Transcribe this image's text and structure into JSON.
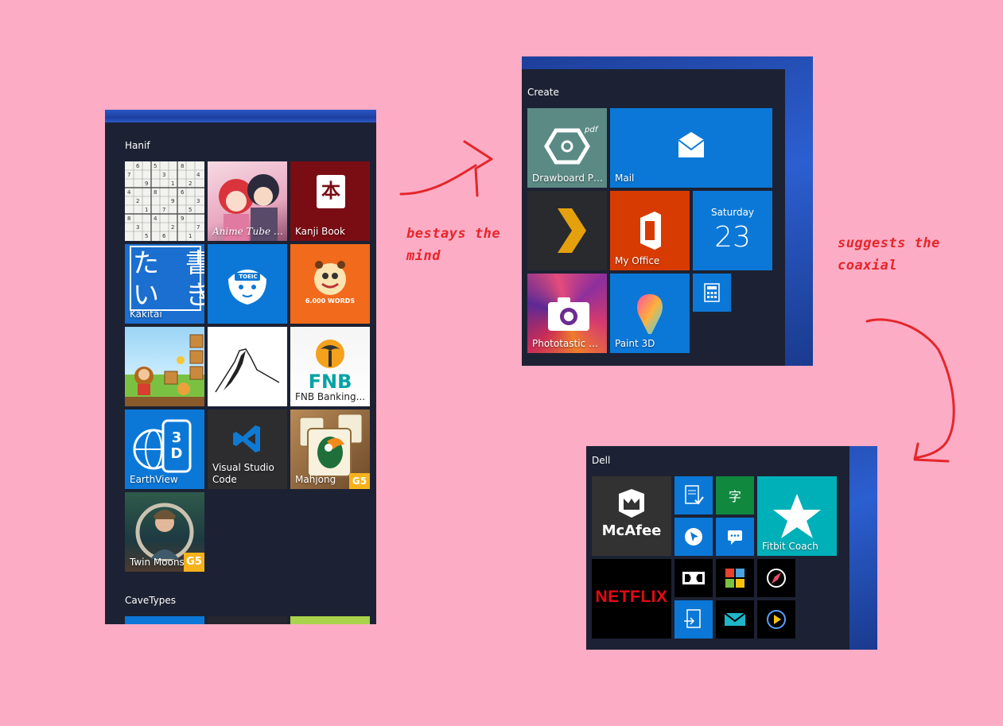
{
  "panel1": {
    "group_title": "Hanif",
    "tiles": [
      {
        "label": "",
        "icon": "sudoku-icon"
      },
      {
        "label": "Anime Tube Pro",
        "icon": "anime-icon"
      },
      {
        "label": "Kanji Book",
        "icon": "kanji-book-icon",
        "glyph": "本"
      },
      {
        "label": "Kakitai",
        "icon": "kakitai-icon",
        "glyph": "た　書\nい　き"
      },
      {
        "label": "",
        "icon": "toeic-icon",
        "glyph": "TOEIC"
      },
      {
        "label": "6.000 WORDS",
        "icon": "words-icon"
      },
      {
        "label": "",
        "icon": "platformer-game-icon"
      },
      {
        "label": "",
        "icon": "mountain-icon"
      },
      {
        "label": "FNB Banking...",
        "icon": "fnb-icon",
        "glyph": "FNB"
      },
      {
        "label": "EarthView",
        "icon": "earthview-icon",
        "glyph": "3D"
      },
      {
        "label": "Visual Studio Code",
        "icon": "vscode-icon"
      },
      {
        "label": "Mahjong",
        "icon": "mahjong-icon",
        "glyph": "G5"
      },
      {
        "label": "Twin Moons",
        "icon": "twin-moons-icon",
        "glyph": "G5"
      }
    ],
    "group2_title": "CaveTypes"
  },
  "panel2": {
    "group_title": "Create",
    "tiles": [
      {
        "label": "Drawboard PDF",
        "icon": "drawboard-pdf-icon",
        "glyph": "pdf"
      },
      {
        "label": "Mail",
        "icon": "mail-icon"
      },
      {
        "label": "",
        "icon": "plex-icon"
      },
      {
        "label": "My Office",
        "icon": "office-icon"
      },
      {
        "label": "Saturday",
        "icon": "calendar-icon",
        "date": "23"
      },
      {
        "label": "Phototastic C...",
        "icon": "camera-icon"
      },
      {
        "label": "Paint 3D",
        "icon": "paint3d-icon"
      },
      {
        "label": "",
        "icon": "calculator-icon"
      }
    ]
  },
  "panel3": {
    "group_title": "Dell",
    "tiles": [
      {
        "label": "McAfee",
        "icon": "mcafee-icon"
      },
      {
        "label": "",
        "icon": "notes-check-icon"
      },
      {
        "label": "",
        "icon": "translate-icon",
        "glyph": "字"
      },
      {
        "label": "Fitbit Coach",
        "icon": "fitbit-star-icon"
      },
      {
        "label": "",
        "icon": "cursor-icon"
      },
      {
        "label": "",
        "icon": "chat-icon"
      },
      {
        "label": "NETFLIX",
        "icon": "netflix-icon"
      },
      {
        "label": "",
        "icon": "dolby-icon"
      },
      {
        "label": "",
        "icon": "puzzle-icon"
      },
      {
        "label": "",
        "icon": "compass-icon"
      },
      {
        "label": "",
        "icon": "file-transfer-icon"
      },
      {
        "label": "",
        "icon": "mail-open-icon"
      },
      {
        "label": "",
        "icon": "media-play-icon"
      }
    ]
  },
  "annotations": {
    "note1": "bestays the\nmind",
    "note2": "suggests the\ncoaxial"
  },
  "colors": {
    "background": "#fdacc5",
    "panel": "#1c2233",
    "tile_blue": "#0b78d7",
    "tile_orange": "#d83b01",
    "ink_red": "#e4262b"
  }
}
